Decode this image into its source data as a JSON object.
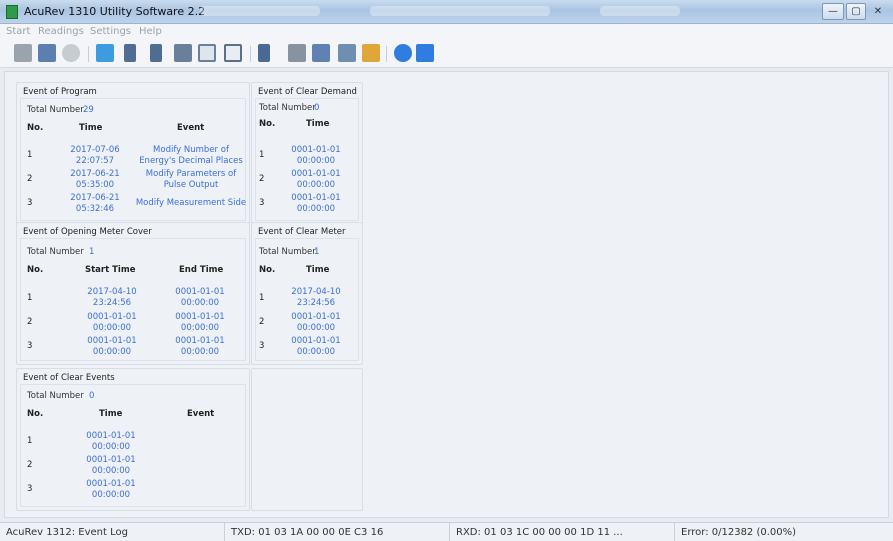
{
  "window": {
    "title": "AcuRev 1310 Utility Software 2.2",
    "controls": {
      "minimize": "—",
      "maximize": "▢",
      "close": "✕"
    }
  },
  "menu": [
    "Start",
    "Readings",
    "Settings",
    "Help"
  ],
  "toolbar_icons": [
    "connect-icon",
    "disconnect-icon",
    "settings-gear-icon",
    "chart-icon",
    "meter-readings-icon",
    "energy-readings-icon",
    "save-icon",
    "calendar-icon",
    "calendar-grid-icon",
    "device-icon",
    "tools-icon",
    "io-icon",
    "event-log-icon",
    "export-icon",
    "help-icon",
    "info-icon"
  ],
  "panels": {
    "program": {
      "title": "Event of Program",
      "total_label": "Total Number",
      "total_value": "29",
      "headers": {
        "no": "No.",
        "time": "Time",
        "event": "Event"
      },
      "rows": [
        {
          "no": "1",
          "date": "2017-07-06",
          "time": "22:07:57",
          "event_l1": "Modify Number of",
          "event_l2": "Energy's Decimal Places"
        },
        {
          "no": "2",
          "date": "2017-06-21",
          "time": "05:35:00",
          "event_l1": "Modify Parameters of",
          "event_l2": "Pulse Output"
        },
        {
          "no": "3",
          "date": "2017-06-21",
          "time": "05:32:46",
          "event_l1": "Modify Measurement Side",
          "event_l2": ""
        }
      ]
    },
    "clear_demand": {
      "title": "Event of Clear Demand",
      "total_label": "Total Number",
      "total_value": "0",
      "headers": {
        "no": "No.",
        "time": "Time"
      },
      "rows": [
        {
          "no": "1",
          "date": "0001-01-01",
          "time": "00:00:00"
        },
        {
          "no": "2",
          "date": "0001-01-01",
          "time": "00:00:00"
        },
        {
          "no": "3",
          "date": "0001-01-01",
          "time": "00:00:00"
        }
      ]
    },
    "opening_cover": {
      "title": "Event of Opening Meter Cover",
      "total_label": "Total Number",
      "total_value": "1",
      "headers": {
        "no": "No.",
        "start": "Start Time",
        "end": "End Time"
      },
      "rows": [
        {
          "no": "1",
          "s_date": "2017-04-10",
          "s_time": "23:24:56",
          "e_date": "0001-01-01",
          "e_time": "00:00:00"
        },
        {
          "no": "2",
          "s_date": "0001-01-01",
          "s_time": "00:00:00",
          "e_date": "0001-01-01",
          "e_time": "00:00:00"
        },
        {
          "no": "3",
          "s_date": "0001-01-01",
          "s_time": "00:00:00",
          "e_date": "0001-01-01",
          "e_time": "00:00:00"
        }
      ]
    },
    "clear_meter": {
      "title": "Event of Clear Meter",
      "total_label": "Total Number",
      "total_value": "1",
      "headers": {
        "no": "No.",
        "time": "Time"
      },
      "rows": [
        {
          "no": "1",
          "date": "2017-04-10",
          "time": "23:24:56"
        },
        {
          "no": "2",
          "date": "0001-01-01",
          "time": "00:00:00"
        },
        {
          "no": "3",
          "date": "0001-01-01",
          "time": "00:00:00"
        }
      ]
    },
    "clear_events": {
      "title": "Event of Clear Events",
      "total_label": "Total Number",
      "total_value": "0",
      "headers": {
        "no": "No.",
        "time": "Time",
        "event": "Event"
      },
      "rows": [
        {
          "no": "1",
          "date": "0001-01-01",
          "time": "00:00:00"
        },
        {
          "no": "2",
          "date": "0001-01-01",
          "time": "00:00:00"
        },
        {
          "no": "3",
          "date": "0001-01-01",
          "time": "00:00:00"
        }
      ]
    }
  },
  "status": {
    "device": "AcuRev 1312: Event Log",
    "txd": "TXD: 01 03 1A 00 00 0E C3 16",
    "rxd": "RXD: 01 03 1C 00 00 00 1D 11 ...",
    "error": "Error: 0/12382  (0.00%)"
  },
  "colors": {
    "value_blue": "#3a6fd8",
    "app_icon_green": "#2e9a4a"
  }
}
